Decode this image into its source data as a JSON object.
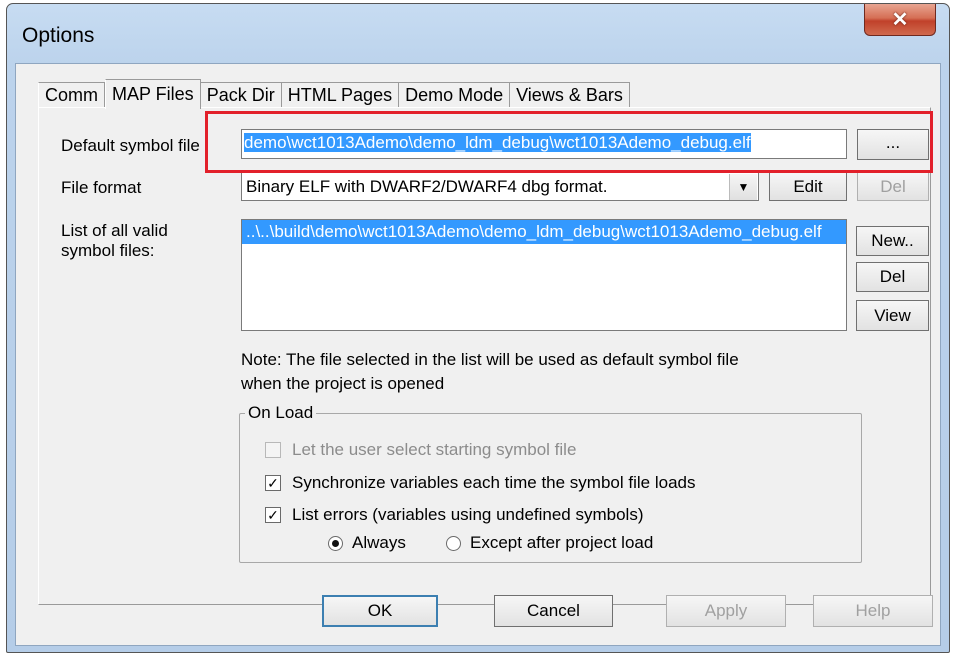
{
  "window": {
    "title": "Options",
    "close_icon": "close-icon"
  },
  "tabs": [
    {
      "label": "Comm"
    },
    {
      "label": "MAP Files"
    },
    {
      "label": "Pack Dir"
    },
    {
      "label": "HTML Pages"
    },
    {
      "label": "Demo Mode"
    },
    {
      "label": "Views & Bars"
    }
  ],
  "active_tab": "MAP Files",
  "default_symbol": {
    "label": "Default symbol file",
    "value": "demo\\wct1013Ademo\\demo_ldm_debug\\wct1013Ademo_debug.elf",
    "browse_label": "..."
  },
  "file_format": {
    "label": "File format",
    "value": "Binary ELF with DWARF2/DWARF4 dbg format.",
    "edit_label": "Edit",
    "del_label": "Del"
  },
  "symbol_list": {
    "label_line1": "List of all valid",
    "label_line2": "symbol files:",
    "items": [
      "..\\..\\build\\demo\\wct1013Ademo\\demo_ldm_debug\\wct1013Ademo_debug.elf"
    ],
    "new_label": "New..",
    "del_label": "Del",
    "view_label": "View"
  },
  "note": {
    "line1": "Note: The file selected in the list will be used as default symbol file",
    "line2": "when the project is opened"
  },
  "on_load": {
    "title": "On Load",
    "let_user_select": {
      "label": "Let the user select starting symbol file",
      "checked": false,
      "enabled": false
    },
    "synchronize": {
      "label": "Synchronize variables each time the symbol file loads",
      "checked": true,
      "check_mark": "✓"
    },
    "list_errors": {
      "label": "List errors (variables using undefined symbols)",
      "checked": true,
      "check_mark": "✓"
    },
    "always": {
      "label": "Always",
      "selected": true
    },
    "except_after": {
      "label": "Except after project load",
      "selected": false
    }
  },
  "buttons": {
    "ok": "OK",
    "cancel": "Cancel",
    "apply": "Apply",
    "help": "Help"
  },
  "colors": {
    "selection": "#3399ff",
    "highlight_box": "#e2202a",
    "close_button": "#c7503a"
  }
}
